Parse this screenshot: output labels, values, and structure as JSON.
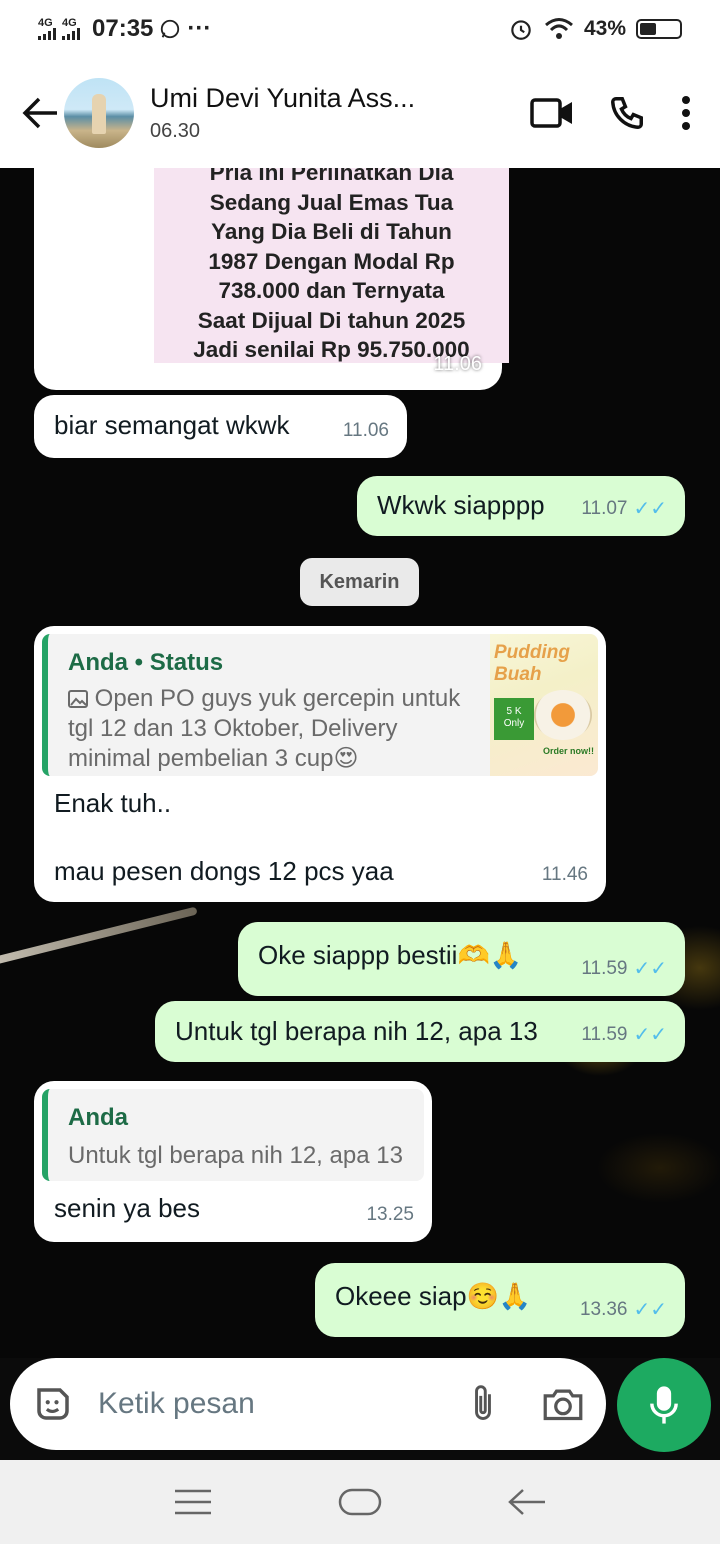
{
  "status_bar": {
    "net1": "4G",
    "net2": "4G",
    "time": "07:35",
    "more": "···",
    "battery_pct": "43%"
  },
  "header": {
    "contact_name": "Umi Devi Yunita Ass...",
    "last_seen": "06.30"
  },
  "messages": {
    "m0": {
      "image_text": [
        "Pria Ini Perlihatkan Dia",
        "Sedang Jual Emas Tua",
        "Yang Dia Beli di Tahun",
        "1987 Dengan Modal Rp",
        "738.000 dan Ternyata",
        "Saat Dijual Di tahun 2025",
        "Jadi senilai Rp 95.750.000"
      ],
      "time": "11.06"
    },
    "m1": {
      "text": "biar semangat wkwk",
      "time": "11.06"
    },
    "m2": {
      "text": "Wkwk siapppp",
      "time": "11.07"
    },
    "date_divider": "Kemarin",
    "m3": {
      "quote_title": "Anda • Status",
      "quote_text_1": "Open PO guys yuk gercepin untuk",
      "quote_text_2": "tgl 12 dan 13 Oktober, Delivery",
      "quote_text_3": "minimal pembelian 3 cup😍",
      "thumb_title_1": "Pudding",
      "thumb_title_2": "Buah",
      "thumb_badge_1": "5 K",
      "thumb_badge_2": "Only",
      "thumb_order": "Order now!!",
      "line1": "Enak tuh..",
      "line2": "mau pesen dongs 12 pcs yaa",
      "time": "11.46"
    },
    "m4": {
      "text": "Oke siappp bestii🫶🙏",
      "time": "11.59"
    },
    "m5": {
      "text": "Untuk tgl berapa nih 12, apa 13",
      "time": "11.59"
    },
    "m6": {
      "quote_title": "Anda",
      "quote_text": "Untuk tgl berapa nih 12, apa 13",
      "text": "senin ya bes",
      "time": "13.25"
    },
    "m7": {
      "text": "Okeee siap☺️🙏",
      "time": "13.36"
    }
  },
  "input": {
    "placeholder": "Ketik pesan"
  },
  "colors": {
    "outgoing_bubble": "#d9fdd3",
    "incoming_bubble": "#ffffff",
    "accent_green": "#1daa61",
    "read_tick": "#53bdeb"
  }
}
